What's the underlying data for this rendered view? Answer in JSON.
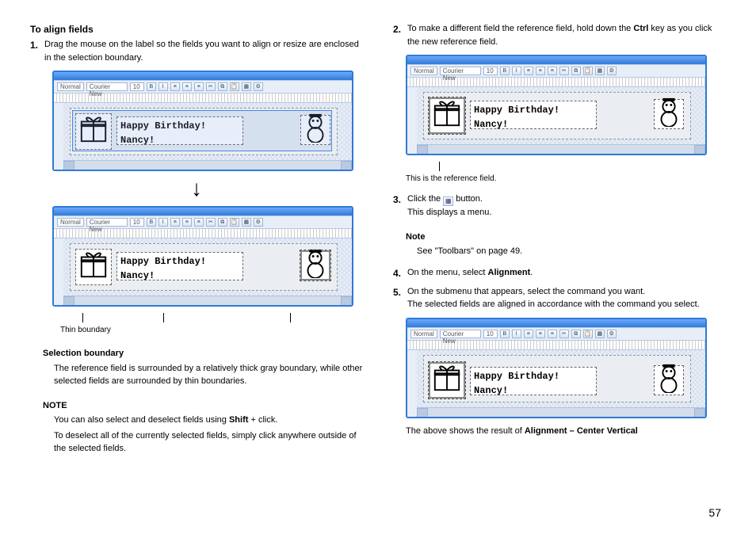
{
  "left": {
    "heading": "To align fields",
    "step1_num": "1.",
    "step1": "Drag the mouse on the label so the fields you want to align or resize are enclosed in the selection boundary.",
    "editor": {
      "style": "Normal",
      "font": "Courier New",
      "size": "10",
      "label_text_line1": "Happy Birthday!",
      "label_text_line2": "Nancy!"
    },
    "thin_boundary": "Thin boundary",
    "sel_boundary_head": "Selection boundary",
    "sel_boundary_body": "The reference field is surrounded by a relatively thick gray boundary, while other selected fields are surrounded by thin boundaries.",
    "note_head": "NOTE",
    "note_body1_pre": "You can also select and deselect fields using ",
    "note_body1_bold": "Shift",
    "note_body1_post": " + click.",
    "note_body2": "To deselect all of the currently selected fields, simply click anywhere outside of the selected fields."
  },
  "right": {
    "step2_num": "2.",
    "step2_pre": "To make a different field the reference field, hold down the ",
    "step2_bold": "Ctrl",
    "step2_post": " key as you click the new reference field.",
    "ref_caption": "This is the reference field.",
    "step3_num": "3.",
    "step3_pre": "Click the ",
    "step3_post": " button.",
    "step3_line2": "This displays a menu.",
    "note_head": "Note",
    "note_body": "See \"Toolbars\" on page 49.",
    "step4_num": "4.",
    "step4_pre": "On the menu, select ",
    "step4_bold": "Alignment",
    "step4_post": ".",
    "step5_num": "5.",
    "step5_line1": "On the submenu that appears, select the command you want.",
    "step5_line2": "The selected fields are aligned in accordance with the command you select.",
    "result_pre": "The above shows the result of ",
    "result_bold": "Alignment – Center Vertical"
  },
  "page_number": "57"
}
